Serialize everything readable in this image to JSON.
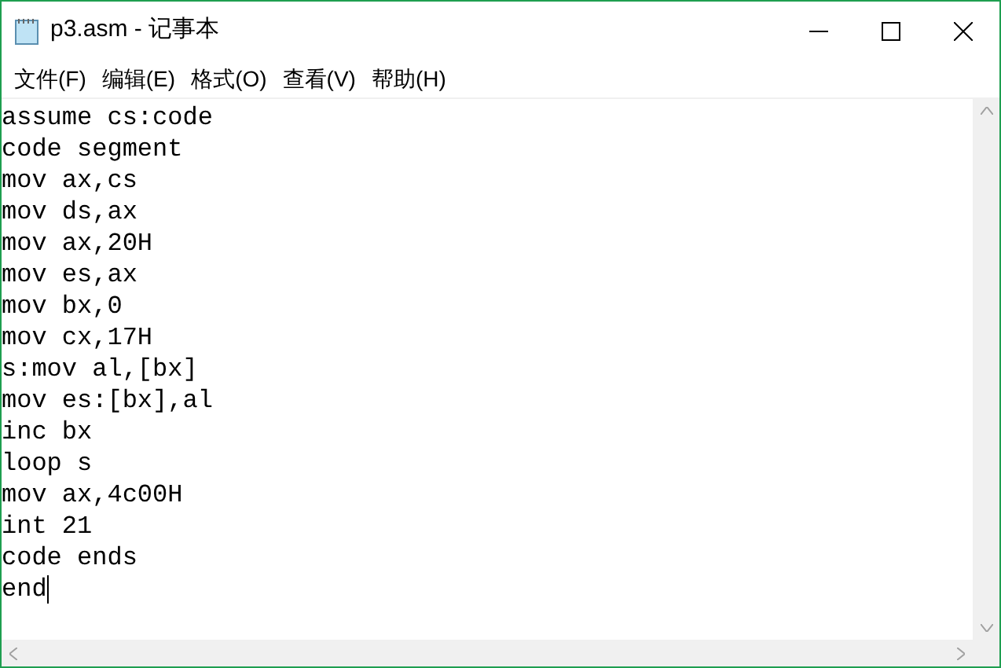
{
  "window": {
    "title": "p3.asm - 记事本"
  },
  "menu": [
    "文件(F)",
    "编辑(E)",
    "格式(O)",
    "查看(V)",
    "帮助(H)"
  ],
  "editor": {
    "lines": [
      "assume cs:code",
      "code segment",
      "mov ax,cs",
      "mov ds,ax",
      "mov ax,20H",
      "mov es,ax",
      "mov bx,0",
      "mov cx,17H",
      "s:mov al,[bx]",
      "mov es:[bx],al",
      "inc bx",
      "loop s",
      "mov ax,4c00H",
      "int 21",
      "code ends",
      "end"
    ]
  }
}
